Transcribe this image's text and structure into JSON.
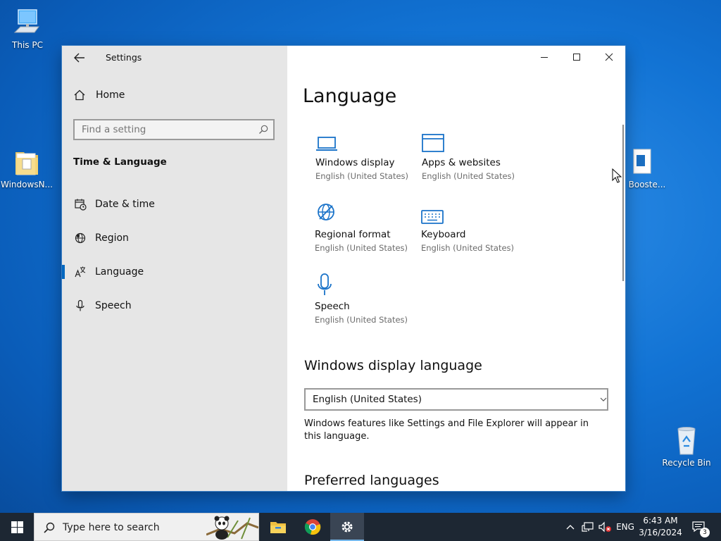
{
  "desktop": {
    "icons": [
      {
        "label": "This PC",
        "icon": "computer-icon"
      },
      {
        "label": "WindowsN...",
        "icon": "folder-icon"
      },
      {
        "label": "Booste...",
        "icon": "app-icon"
      },
      {
        "label": "Recycle Bin",
        "icon": "recycle-bin-icon"
      }
    ]
  },
  "window": {
    "title": "Settings",
    "controls": {
      "minimize": "minimize-icon",
      "maximize": "maximize-icon",
      "close": "close-icon"
    }
  },
  "sidebar": {
    "home_label": "Home",
    "search_placeholder": "Find a setting",
    "section_title": "Time & Language",
    "items": [
      {
        "label": "Date & time",
        "icon": "calendar-clock-icon",
        "active": false
      },
      {
        "label": "Region",
        "icon": "globe-icon",
        "active": false
      },
      {
        "label": "Language",
        "icon": "language-icon",
        "active": true
      },
      {
        "label": "Speech",
        "icon": "microphone-icon",
        "active": false
      }
    ]
  },
  "main": {
    "heading": "Language",
    "tiles": [
      {
        "name": "Windows display",
        "sub": "English (United States)",
        "icon": "laptop-icon"
      },
      {
        "name": "Apps & websites",
        "sub": "English (United States)",
        "icon": "app-window-icon"
      },
      {
        "name": "Regional format",
        "sub": "English (United States)",
        "icon": "globe-format-icon"
      },
      {
        "name": "Keyboard",
        "sub": "English (United States)",
        "icon": "keyboard-icon"
      },
      {
        "name": "Speech",
        "sub": "English (United States)",
        "icon": "microphone-icon"
      }
    ],
    "display_language_heading": "Windows display language",
    "display_language_value": "English (United States)",
    "display_language_desc": "Windows features like Settings and File Explorer will appear in this language.",
    "preferred_heading": "Preferred languages"
  },
  "taskbar": {
    "search_placeholder": "Type here to search",
    "apps": [
      "file-explorer-icon",
      "chrome-icon",
      "settings-icon"
    ],
    "tray": {
      "language": "ENG",
      "time": "6:43 AM",
      "date": "3/16/2024",
      "notification_count": "3"
    }
  },
  "colors": {
    "accent": "#0067c0",
    "icon_blue": "#1a73c9",
    "desktop": "#1273d4",
    "taskbar": "#1d2733"
  }
}
